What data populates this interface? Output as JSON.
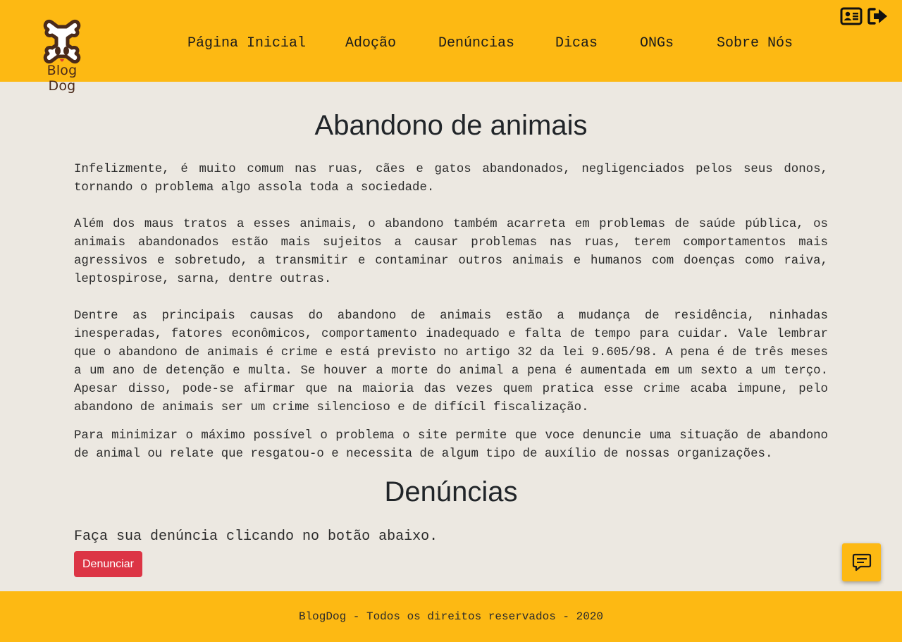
{
  "brand": {
    "logo_text": "Blog Dog",
    "primary_color": "#fdb913",
    "danger_color": "#dc3545"
  },
  "nav": {
    "items": [
      {
        "label": "Página Inicial"
      },
      {
        "label": "Adoção"
      },
      {
        "label": "Denúncias"
      },
      {
        "label": "Dicas"
      },
      {
        "label": "ONGs"
      },
      {
        "label": "Sobre Nós"
      }
    ],
    "icons": {
      "profile": "id-card-icon",
      "logout": "sign-out-icon"
    }
  },
  "main": {
    "title": "Abandono de animais",
    "paragraphs": [
      "Infelizmente, é muito comum nas ruas, cães e gatos abandonados, negligenciados pelos seus donos, tornando o problema algo assola toda a sociedade.",
      "Além dos maus tratos a esses animais, o abandono também acarreta em problemas de saúde pública, os animais abandonados estão mais sujeitos a causar problemas nas ruas, terem comportamentos mais agressivos e sobretudo, a transmitir e contaminar outros animais e humanos com doenças como raiva, leptospirose, sarna, dentre outras.",
      "Dentre as principais causas do abandono de animais estão a mudança de residência, ninhadas inesperadas, fatores econômicos, comportamento inadequado e falta de tempo para cuidar. Vale lembrar que o abandono de animais é crime e está previsto no artigo 32 da lei 9.605/98. A pena é de três meses a um ano de detenção e multa. Se houver a morte do animal a pena é aumentada em um sexto a um terço. Apesar disso, pode-se afirmar que na maioria das vezes quem pratica esse crime acaba impune, pelo abandono de animais ser um crime silencioso e de difícil fiscalização.",
      "Para minimizar o máximo possível o problema o site permite que voce denuncie uma situação de abandono de animal ou relate que resgatou-o e necessita de algum tipo de auxílio de nossas organizações."
    ],
    "section_title": "Denúncias",
    "cta_text": "Faça sua denúncia clicando no botão abaixo.",
    "cta_button": "Denunciar"
  },
  "chat": {
    "icon": "chat-bubble-icon"
  },
  "footer": {
    "text": "BlogDog - Todos os direitos reservados - 2020"
  }
}
